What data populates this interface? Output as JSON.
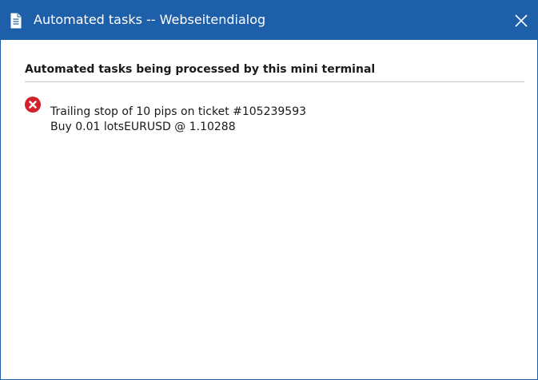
{
  "window": {
    "title": "Automated tasks -- Webseitendialog",
    "icons": {
      "title": "document-icon",
      "close": "close-icon"
    },
    "colors": {
      "titlebar": "#1d5fa8",
      "error": "#d1222b"
    }
  },
  "main": {
    "heading": "Automated tasks being processed by this mini terminal",
    "tasks": [
      {
        "line1": "Trailing stop of 10 pips on ticket #105239593",
        "line2": "Buy 0.01 lotsEURUSD @ 1.10288",
        "icon": "error-remove-icon"
      }
    ]
  }
}
